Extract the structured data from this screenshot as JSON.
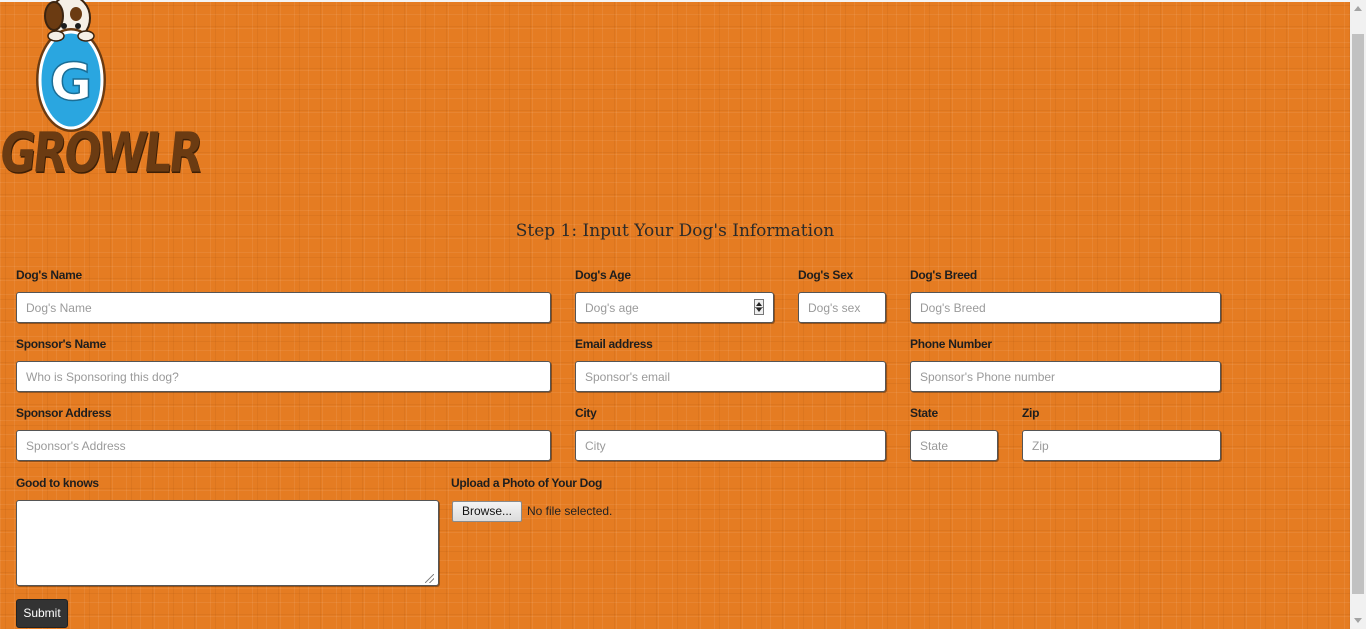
{
  "brand": {
    "logo_text": "GROWLR",
    "badge_letter": "G"
  },
  "form": {
    "heading": "Step 1: Input Your Dog's Information",
    "fields": {
      "dog_name": {
        "label": "Dog's Name",
        "placeholder": "Dog's Name"
      },
      "dog_age": {
        "label": "Dog's Age",
        "placeholder": "Dog's age"
      },
      "dog_sex": {
        "label": "Dog's Sex",
        "placeholder": "Dog's sex"
      },
      "dog_breed": {
        "label": "Dog's Breed",
        "placeholder": "Dog's Breed"
      },
      "sponsor_name": {
        "label": "Sponsor's Name",
        "placeholder": "Who is Sponsoring this dog?"
      },
      "email": {
        "label": "Email address",
        "placeholder": "Sponsor's email"
      },
      "phone": {
        "label": "Phone Number",
        "placeholder": "Sponsor's Phone number"
      },
      "address": {
        "label": "Sponsor Address",
        "placeholder": "Sponsor's Address"
      },
      "city": {
        "label": "City",
        "placeholder": "City"
      },
      "state": {
        "label": "State",
        "placeholder": "State"
      },
      "zip": {
        "label": "Zip",
        "placeholder": "Zip"
      },
      "good_to_know": {
        "label": "Good to knows",
        "value": ""
      },
      "photo": {
        "label": "Upload a Photo of Your Dog",
        "button": "Browse...",
        "status": "No file selected."
      }
    },
    "submit_label": "Submit"
  },
  "colors": {
    "background": "#e57c22",
    "logo_brown": "#6b3b12",
    "badge_blue": "#2aa6e0",
    "button_dark": "#333333"
  }
}
